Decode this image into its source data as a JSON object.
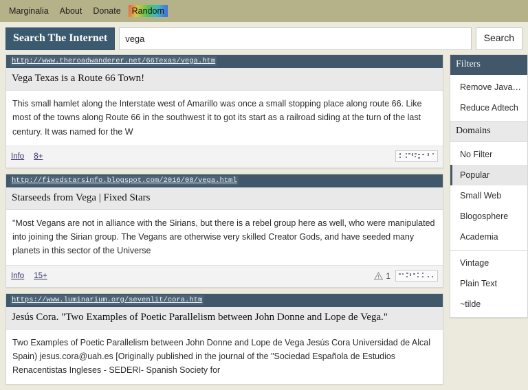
{
  "nav": {
    "items": [
      {
        "label": "Marginalia",
        "style": "plain"
      },
      {
        "label": "About",
        "style": "plain"
      },
      {
        "label": "Donate",
        "style": "plain"
      },
      {
        "label": "Random",
        "style": "rainbow"
      }
    ]
  },
  "search": {
    "label_button": "Search The Internet",
    "value": "vega",
    "placeholder": "",
    "submit_label": "Search"
  },
  "results": [
    {
      "url": "http://www.theroadwanderer.net/66Texas/vega.htm",
      "title": "Vega Texas is a Route 66 Town!",
      "snippet": "This small hamlet along the Interstate west of Amarillo was once a small stopping place along route 66. Like most of the towns along Route 66 in the southwest it to got its start as a railroad siding at the turn of the last century. It was named for the W",
      "info_label": "Info",
      "count_label": "8+",
      "warning_count": "",
      "has_warning": false
    },
    {
      "url": "http://fixedstarsinfo.blogspot.com/2016/08/vega.html",
      "title": "Starseeds from Vega | Fixed Stars",
      "snippet": "\"Most Vegans are not in alliance with the Sirians, but there is a rebel group here as well, who were manipulated into joining the Sirian group. The Vegans are otherwise very skilled Creator Gods, and have seeded many planets in this sector of the Universe",
      "info_label": "Info",
      "count_label": "15+",
      "warning_count": "1",
      "has_warning": true
    },
    {
      "url": "https://www.luminarium.org/sevenlit/cora.htm",
      "title": "Jesús Cora. \"Two Examples of Poetic Parallelism between John Donne and Lope de Vega.\"",
      "snippet": "Two Examples of Poetic Parallelism between John Donne and Lope de Vega Jesús Cora Universidad de Alcal Spain) jesus.cora@uah.es [Originally published in the journal of the \"Sociedad Española de Estudios Renacentistas Ingleses - SEDERI- Spanish Society for",
      "info_label": "",
      "count_label": "",
      "warning_count": "",
      "has_warning": false
    }
  ],
  "sidebar": {
    "filters_header": "Filters",
    "filters": [
      {
        "label": "Remove Javascript",
        "selected": false
      },
      {
        "label": "Reduce Adtech",
        "selected": false
      }
    ],
    "domains_header": "Domains",
    "domains_group_1": [
      {
        "label": "No Filter",
        "selected": false
      },
      {
        "label": "Popular",
        "selected": true
      },
      {
        "label": "Small Web",
        "selected": false
      },
      {
        "label": "Blogosphere",
        "selected": false
      },
      {
        "label": "Academia",
        "selected": false
      }
    ],
    "domains_group_2": [
      {
        "label": "Vintage",
        "selected": false
      },
      {
        "label": "Plain Text",
        "selected": false
      },
      {
        "label": "~tilde",
        "selected": false
      }
    ]
  },
  "colors": {
    "nav_background": "#b5b189",
    "page_background": "#ece9dd",
    "accent_dark": "#41586a",
    "button_dark": "#3b5a70",
    "link": "#33306b",
    "selected_row": "#e7e7e7"
  },
  "icons": {
    "warning": "warning-triangle-icon",
    "dotmap": "page-structure-thumbnail-icon"
  }
}
